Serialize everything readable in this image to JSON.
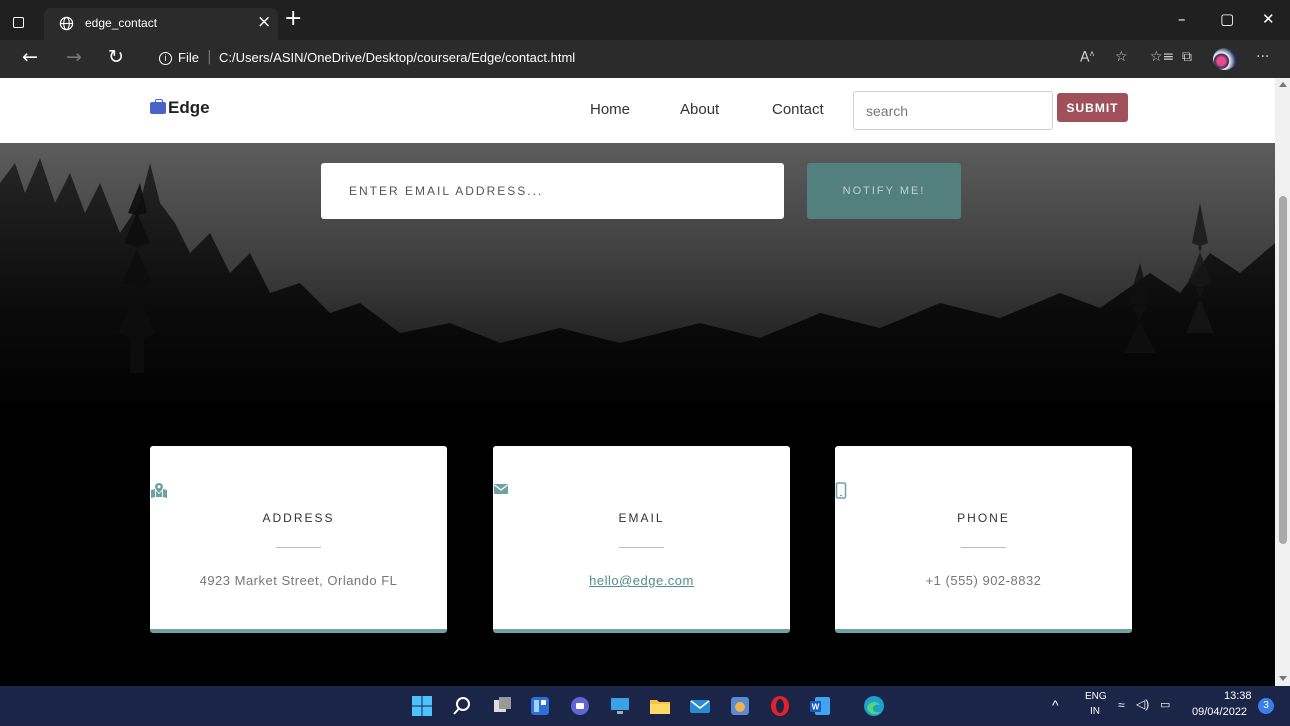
{
  "browser": {
    "tab_title": "edge_contact",
    "tab_close": "×",
    "new_tab": "+",
    "url_scheme_label": "File",
    "url": "C:/Users/ASIN/OneDrive/Desktop/coursera/Edge/contact.html",
    "window_controls": {
      "minimize": "–",
      "restore": "▢",
      "close": "✕"
    },
    "more_menu": "···"
  },
  "navbar": {
    "brand": "Edge",
    "links": [
      "Home",
      "About",
      "Contact"
    ],
    "search_placeholder": "search",
    "submit_label": "SUBMIT"
  },
  "subscribe": {
    "email_placeholder": "ENTER EMAIL ADDRESS...",
    "button_label": "NOTIFY ME!"
  },
  "cards": [
    {
      "title": "ADDRESS",
      "value": "4923 Market Street, Orlando FL",
      "icon": "map-marked-icon"
    },
    {
      "title": "EMAIL",
      "value": "hello@edge.com",
      "icon": "envelope-icon"
    },
    {
      "title": "PHONE",
      "value": "+1 (555) 902-8832",
      "icon": "mobile-phone-icon"
    }
  ],
  "taskbar": {
    "language": "ENG",
    "region": "IN",
    "time": "13:38",
    "date": "09/04/2022",
    "notifications": "3"
  },
  "colors": {
    "accent": "#6fa3a3",
    "notify_button": "#537f7f",
    "submit_button": "#a0505a",
    "brand_icon": "#4a63c8",
    "taskbar": "#1a2548"
  }
}
